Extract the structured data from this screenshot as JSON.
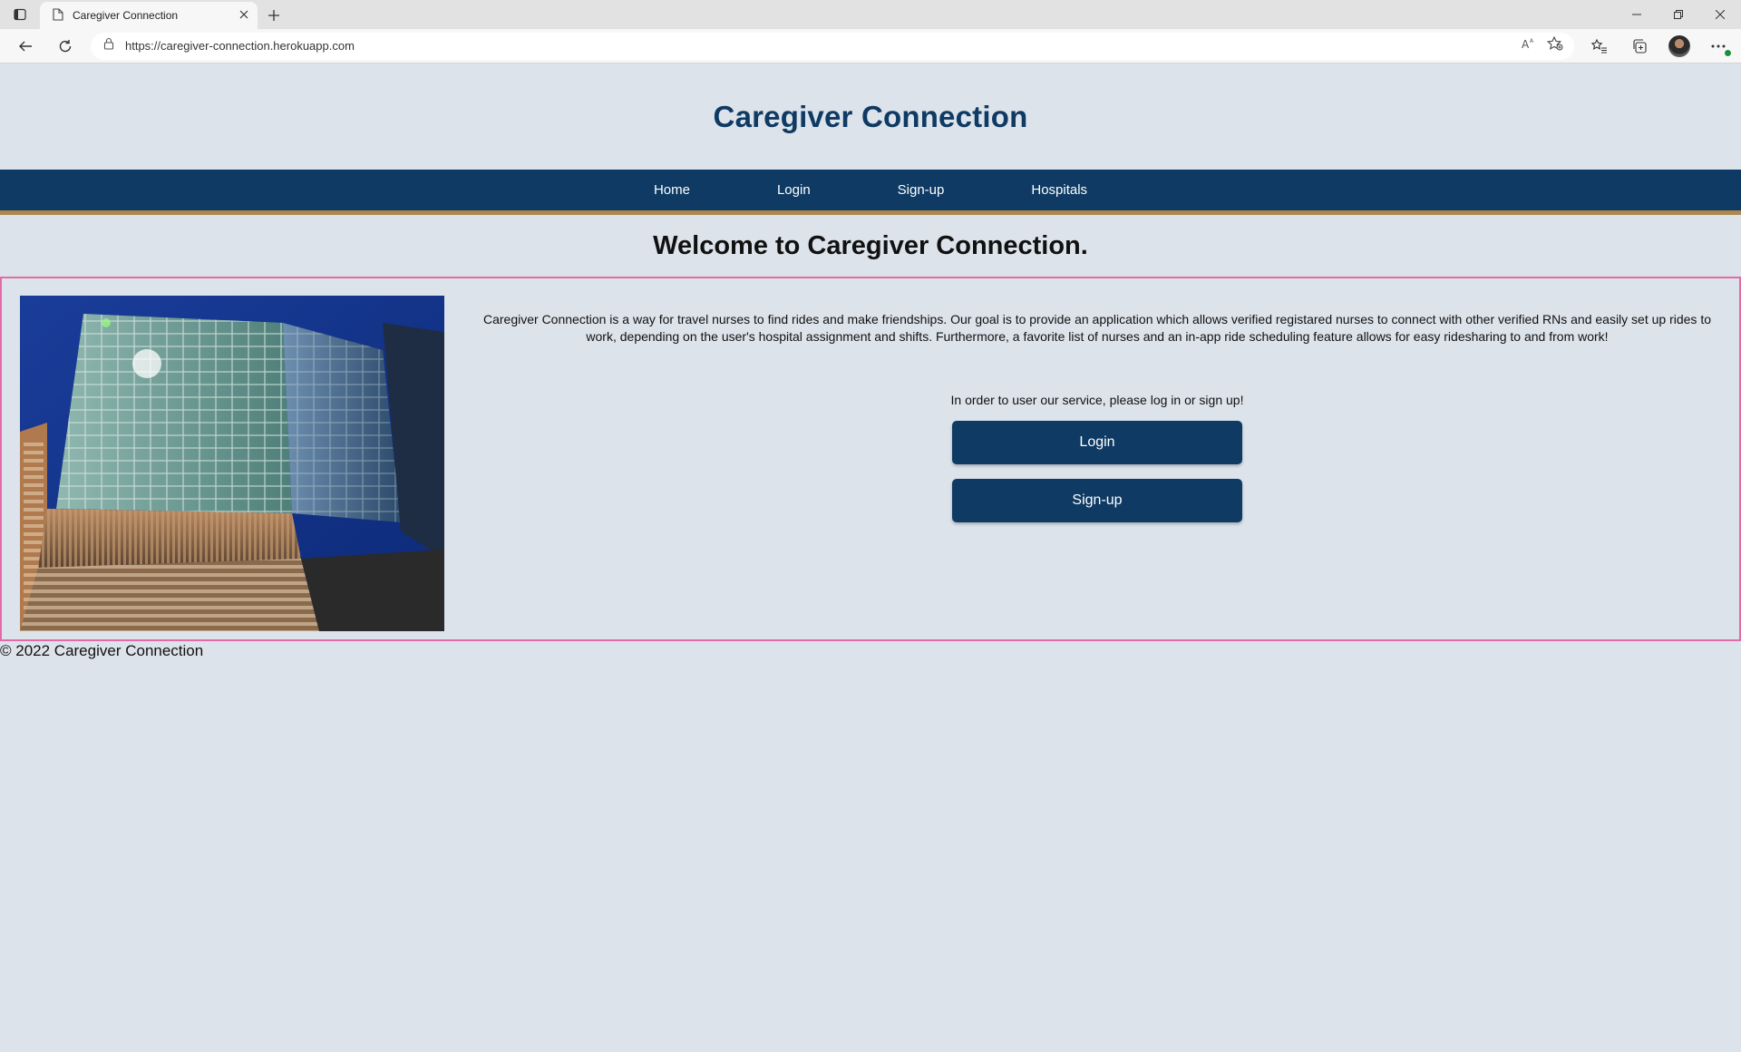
{
  "browser": {
    "tab_title": "Caregiver Connection",
    "url": "https://caregiver-connection.herokuapp.com",
    "icons": [
      "sidebar-icon",
      "page-icon",
      "close-icon",
      "plus-icon",
      "minimize-icon",
      "restore-icon",
      "close-window-icon",
      "back-icon",
      "refresh-icon",
      "lock-icon",
      "read-aloud-icon",
      "favorite-add-icon",
      "favorites-icon",
      "collections-icon",
      "avatar",
      "more-icon"
    ]
  },
  "site": {
    "title": "Caregiver Connection",
    "nav": [
      "Home",
      "Login",
      "Sign-up",
      "Hospitals"
    ],
    "welcome": "Welcome to Caregiver Connection.",
    "intro": "Caregiver Connection is a way for travel nurses to find rides and make friendships. Our goal is to provide an application which allows verified registared nurses to connect with other verified RNs and easily set up rides to work, depending on the user's hospital assignment and shifts. Furthermore, a favorite list of nurses and an in-app ride scheduling feature allows for easy ridesharing to and from work!",
    "prompt": "In order to user our service, please log in or sign up!",
    "login_button": "Login",
    "signup_button": "Sign-up",
    "footer": "© 2022 Caregiver Connection"
  },
  "colors": {
    "page_bg": "#dde3eb",
    "navy": "#0e3a63",
    "gold": "#b0874f",
    "pink_border": "#e36aa8"
  }
}
